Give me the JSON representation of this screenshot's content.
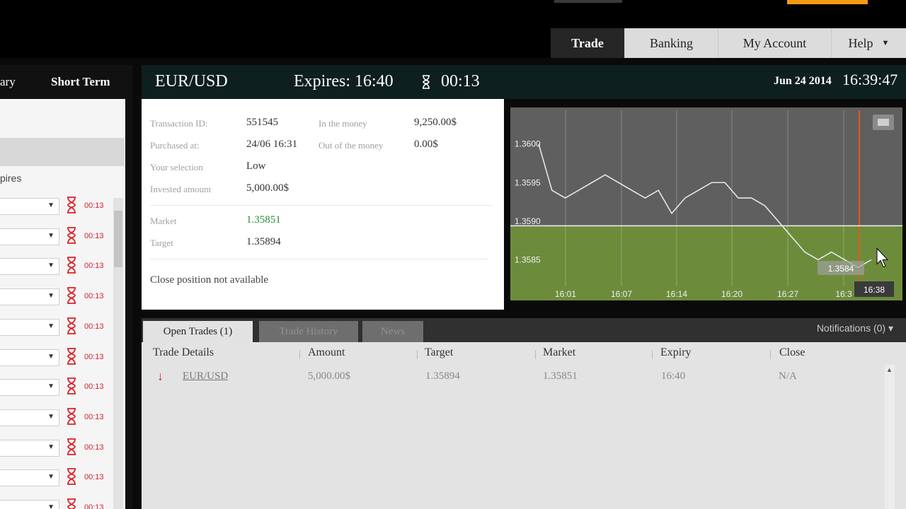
{
  "topnav": {
    "items": [
      "Trade",
      "Banking",
      "My Account",
      "Help"
    ],
    "active": "Trade"
  },
  "left": {
    "tab_partial": "ary",
    "tab_short_term": "Short Term",
    "expires_label": "pires",
    "countdown": "00:13"
  },
  "header": {
    "pair": "EUR/USD",
    "expires": "Expires: 16:40",
    "countdown": "00:13",
    "date": "Jun 24 2014",
    "clock": "16:39:47"
  },
  "details": {
    "transaction_id_label": "Transaction ID:",
    "transaction_id": "551545",
    "purchased_at_label": "Purchased at:",
    "purchased_at": "24/06 16:31",
    "selection_label": "Your selection",
    "selection": "Low",
    "invested_label": "Invested amount",
    "invested": "5,000.00$",
    "in_money_label": "In the money",
    "in_money": "9,250.00$",
    "out_money_label": "Out of the money",
    "out_money": "0.00$",
    "market_label": "Market",
    "market": "1.35851",
    "target_label": "Target",
    "target": "1.35894",
    "close_note": "Close position not available"
  },
  "chart_data": {
    "type": "line",
    "x_ticks": [
      "16:01",
      "16:07",
      "16:14",
      "16:20",
      "16:27",
      "16:3"
    ],
    "y_ticks": [
      "1.3600",
      "1.3595",
      "1.3590",
      "1.3585"
    ],
    "current_price_label": "1.3584",
    "current_time_label": "16:38",
    "target_level": 1.35894,
    "colors": {
      "upper_bg": "#5f5f5f",
      "lower_bg": "#6c8c3c",
      "line": "#e6e6e6",
      "expiry_line": "#e05a1c"
    },
    "series": [
      {
        "values": [
          1.36,
          1.3594,
          1.3593,
          1.3594,
          1.3595,
          1.3596,
          1.3595,
          1.3594,
          1.3593,
          1.3594,
          1.3591,
          1.3593,
          1.3594,
          1.3595,
          1.3595,
          1.3593,
          1.3593,
          1.3592,
          1.359,
          1.3588,
          1.3586,
          1.3585,
          1.3586,
          1.3585,
          1.3584,
          1.3585
        ]
      }
    ]
  },
  "bottom": {
    "tabs": [
      "Open Trades (1)",
      "Trade History",
      "News"
    ],
    "notifications": "Notifications (0)",
    "columns": [
      "Trade Details",
      "Amount",
      "Target",
      "Market",
      "Expiry",
      "Close"
    ],
    "rows": [
      {
        "asset": "EUR/USD",
        "amount": "5,000.00$",
        "target": "1.35894",
        "market": "1.35851",
        "expiry": "16:40",
        "close": "N/A"
      }
    ]
  }
}
